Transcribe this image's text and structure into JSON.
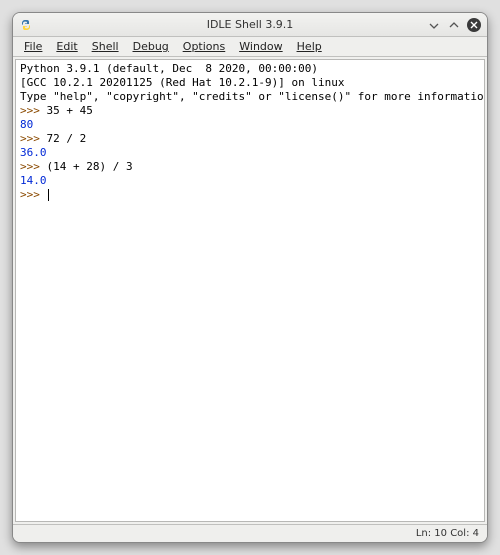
{
  "window": {
    "title": "IDLE Shell 3.9.1"
  },
  "menu": {
    "items": [
      "File",
      "Edit",
      "Shell",
      "Debug",
      "Options",
      "Window",
      "Help"
    ]
  },
  "shell": {
    "banner_line1": "Python 3.9.1 (default, Dec  8 2020, 00:00:00)",
    "banner_line2": "[GCC 10.2.1 20201125 (Red Hat 10.2.1-9)] on linux",
    "banner_line3": "Type \"help\", \"copyright\", \"credits\" or \"license()\" for more information.",
    "prompt": ">>>",
    "entries": [
      {
        "in": "35 + 45",
        "out": "80"
      },
      {
        "in": "72 / 2",
        "out": "36.0"
      },
      {
        "in": "(14 + 28) / 3",
        "out": "14.0"
      }
    ]
  },
  "status": {
    "text": "Ln: 10  Col: 4"
  }
}
